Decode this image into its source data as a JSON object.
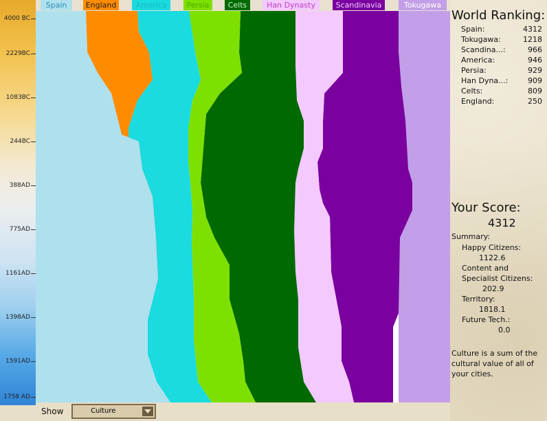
{
  "timeline": {
    "labels": [
      "4000 BC",
      "2229BC",
      "1083BC",
      "244BC",
      "388AD",
      "775AD",
      "1161AD",
      "1398AD",
      "1591AD",
      "1758 AD"
    ]
  },
  "legend": [
    {
      "name": "Spain",
      "color": "#aee0ee",
      "text_color": "#2e8fb0"
    },
    {
      "name": "England",
      "color": "#ff8c00",
      "text_color": "#222222"
    },
    {
      "name": "America",
      "color": "#19dbe0",
      "text_color": "#19b8c0"
    },
    {
      "name": "Persia",
      "color": "#7ee000",
      "text_color": "#4ca800"
    },
    {
      "name": "Celts",
      "color": "#006a00",
      "text_color": "#c8f0c8"
    },
    {
      "name": "Han Dynasty",
      "color": "#f3c9ff",
      "text_color": "#c040c0"
    },
    {
      "name": "Scandinavia",
      "color": "#7a009f",
      "text_color": "#f0d0ff"
    },
    {
      "name": "Tokugawa",
      "color": "#c29fe8",
      "text_color": "#ffffff"
    }
  ],
  "ranking": {
    "title": "World Ranking:",
    "rows": [
      {
        "name": "Spain:",
        "value": "4312"
      },
      {
        "name": "Tokugawa:",
        "value": "1218"
      },
      {
        "name": "Scandina...:",
        "value": "966"
      },
      {
        "name": "America:",
        "value": "946"
      },
      {
        "name": "Persia:",
        "value": "929"
      },
      {
        "name": "Han Dyna...:",
        "value": "909"
      },
      {
        "name": "Celts:",
        "value": "809"
      },
      {
        "name": "England:",
        "value": "250"
      }
    ]
  },
  "score": {
    "title": "Your Score:",
    "value": "4312",
    "summary_label": "Summary:",
    "happy_label": "Happy Citizens:",
    "happy_value": "1122.6",
    "content_label_1": "Content and",
    "content_label_2": "Specialist Citizens:",
    "content_value": "202.9",
    "territory_label": "Territory:",
    "territory_value": "1818.1",
    "future_label": "Future Tech.:",
    "future_value": "0.0",
    "note_1": "Culture is a sum of the",
    "note_2": "cultural value of all of",
    "note_3": "your cities."
  },
  "show": {
    "label": "Show",
    "selected": "Culture"
  }
}
